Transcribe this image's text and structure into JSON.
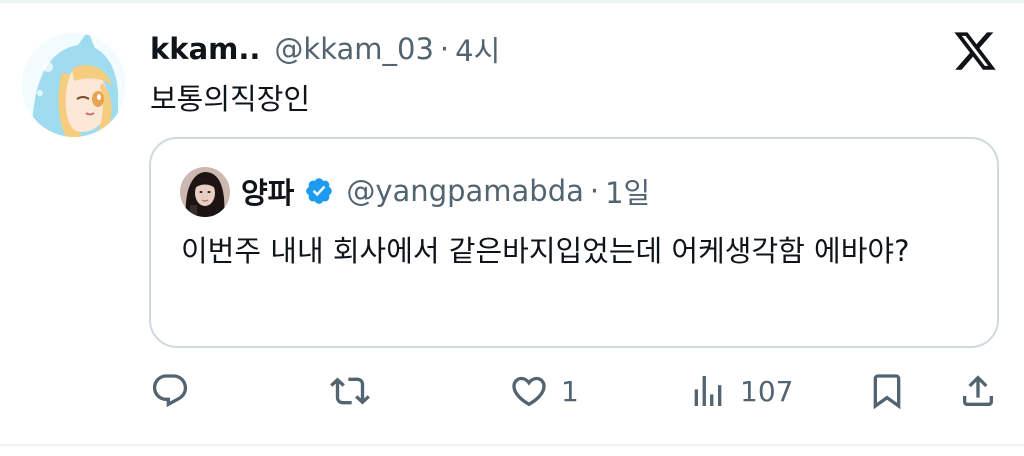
{
  "tweet": {
    "display_name": "kkam..",
    "handle": "@kkam_03",
    "separator": "·",
    "time": "4시",
    "text": "보통의직장인"
  },
  "quoted": {
    "display_name": "양파",
    "handle": "@yangpamabda",
    "separator": "·",
    "time": "1일",
    "text": "이번주 내내 회사에서 같은바지입었는데 어케생각함 에바야?"
  },
  "actions": {
    "like_count": "1",
    "view_count": "107"
  },
  "icons": [
    "x-logo-icon",
    "verified-icon",
    "reply-icon",
    "retweet-icon",
    "like-icon",
    "views-icon",
    "bookmark-icon",
    "share-icon"
  ],
  "colors": {
    "text": "#0f1419",
    "secondary": "#536471",
    "verified": "#1d9bf0",
    "border": "#cfd9de"
  }
}
